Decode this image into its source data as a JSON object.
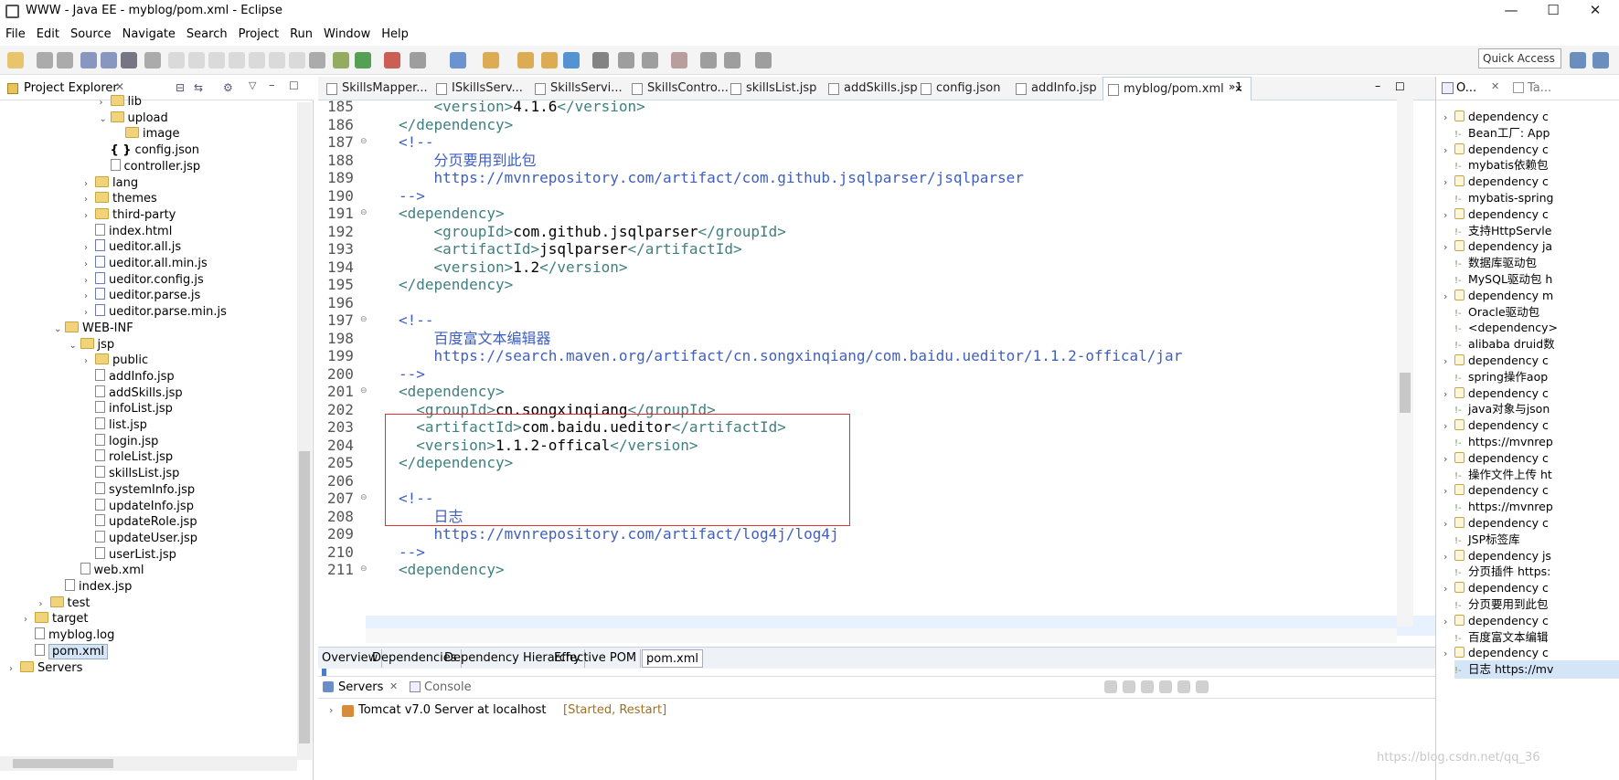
{
  "window": {
    "title": "WWW - Java EE - myblog/pom.xml - Eclipse"
  },
  "menu": [
    "File",
    "Edit",
    "Source",
    "Navigate",
    "Search",
    "Project",
    "Run",
    "Window",
    "Help"
  ],
  "quick_access": "Quick Access",
  "project_explorer": {
    "title": "Project Explorer",
    "items": [
      {
        "label": "lib",
        "type": "folder",
        "depth": 5,
        "twisty": ">"
      },
      {
        "label": "upload",
        "type": "folder",
        "depth": 5,
        "twisty": "v"
      },
      {
        "label": "image",
        "type": "folder",
        "depth": 6,
        "twisty": ""
      },
      {
        "label": "config.json",
        "type": "json",
        "depth": 5,
        "twisty": ""
      },
      {
        "label": "controller.jsp",
        "type": "file",
        "depth": 5,
        "twisty": ""
      },
      {
        "label": "lang",
        "type": "folder",
        "depth": 4,
        "twisty": ">"
      },
      {
        "label": "themes",
        "type": "folder",
        "depth": 4,
        "twisty": ">"
      },
      {
        "label": "third-party",
        "type": "folder",
        "depth": 4,
        "twisty": ">"
      },
      {
        "label": "index.html",
        "type": "file",
        "depth": 4,
        "twisty": ""
      },
      {
        "label": "ueditor.all.js",
        "type": "js",
        "depth": 4,
        "twisty": ">"
      },
      {
        "label": "ueditor.all.min.js",
        "type": "js",
        "depth": 4,
        "twisty": ">"
      },
      {
        "label": "ueditor.config.js",
        "type": "js",
        "depth": 4,
        "twisty": ">"
      },
      {
        "label": "ueditor.parse.js",
        "type": "js",
        "depth": 4,
        "twisty": ">"
      },
      {
        "label": "ueditor.parse.min.js",
        "type": "js",
        "depth": 4,
        "twisty": ">"
      },
      {
        "label": "WEB-INF",
        "type": "folder",
        "depth": 2,
        "twisty": "v"
      },
      {
        "label": "jsp",
        "type": "folder",
        "depth": 3,
        "twisty": "v"
      },
      {
        "label": "public",
        "type": "folder",
        "depth": 4,
        "twisty": ">"
      },
      {
        "label": "addInfo.jsp",
        "type": "file",
        "depth": 4,
        "twisty": ""
      },
      {
        "label": "addSkills.jsp",
        "type": "file",
        "depth": 4,
        "twisty": ""
      },
      {
        "label": "infoList.jsp",
        "type": "file",
        "depth": 4,
        "twisty": ""
      },
      {
        "label": "list.jsp",
        "type": "file",
        "depth": 4,
        "twisty": ""
      },
      {
        "label": "login.jsp",
        "type": "file",
        "depth": 4,
        "twisty": ""
      },
      {
        "label": "roleList.jsp",
        "type": "file",
        "depth": 4,
        "twisty": ""
      },
      {
        "label": "skillsList.jsp",
        "type": "file",
        "depth": 4,
        "twisty": ""
      },
      {
        "label": "systemInfo.jsp",
        "type": "file",
        "depth": 4,
        "twisty": ""
      },
      {
        "label": "updateInfo.jsp",
        "type": "file",
        "depth": 4,
        "twisty": ""
      },
      {
        "label": "updateRole.jsp",
        "type": "file",
        "depth": 4,
        "twisty": ""
      },
      {
        "label": "updateUser.jsp",
        "type": "file",
        "depth": 4,
        "twisty": ""
      },
      {
        "label": "userList.jsp",
        "type": "file",
        "depth": 4,
        "twisty": ""
      },
      {
        "label": "web.xml",
        "type": "file",
        "depth": 3,
        "twisty": ""
      },
      {
        "label": "index.jsp",
        "type": "file",
        "depth": 2,
        "twisty": ""
      },
      {
        "label": "test",
        "type": "folder",
        "depth": 1,
        "twisty": ">"
      },
      {
        "label": "target",
        "type": "folder",
        "depth": 0,
        "twisty": ">"
      },
      {
        "label": "myblog.log",
        "type": "file",
        "depth": 0,
        "twisty": ""
      },
      {
        "label": "pom.xml",
        "type": "file",
        "depth": 0,
        "twisty": "",
        "selected": true
      },
      {
        "label": "Servers",
        "type": "folder",
        "depth": -1,
        "twisty": ">"
      }
    ]
  },
  "editor_tabs": [
    {
      "label": "SkillsMapper...",
      "active": false
    },
    {
      "label": "ISkillsServ...",
      "active": false
    },
    {
      "label": "SkillsServi...",
      "active": false
    },
    {
      "label": "SkillsContro...",
      "active": false
    },
    {
      "label": "skillsList.jsp",
      "active": false
    },
    {
      "label": "addSkills.jsp",
      "active": false
    },
    {
      "label": "config.json",
      "active": false
    },
    {
      "label": "addInfo.jsp",
      "active": false
    },
    {
      "label": "myblog/pom.xml",
      "active": true
    }
  ],
  "editor_tabs_overflow": "»1",
  "code_lines": [
    {
      "n": "185",
      "parts": [
        [
          "tag",
          "    <version>"
        ],
        [
          "txt",
          "4.1.6"
        ],
        [
          "tag",
          "</version>"
        ]
      ]
    },
    {
      "n": "186",
      "parts": [
        [
          "tag",
          "</dependency>"
        ]
      ]
    },
    {
      "n": "187",
      "parts": [
        [
          "cm",
          "<!--"
        ]
      ]
    },
    {
      "n": "188",
      "parts": [
        [
          "cm",
          "    分页要用到此包"
        ]
      ]
    },
    {
      "n": "189",
      "parts": [
        [
          "cm",
          "    https://mvnrepository.com/artifact/com.github.jsqlparser/jsqlparser"
        ]
      ]
    },
    {
      "n": "190",
      "parts": [
        [
          "cm",
          "-->"
        ]
      ]
    },
    {
      "n": "191",
      "parts": [
        [
          "tag",
          "<dependency>"
        ]
      ]
    },
    {
      "n": "192",
      "parts": [
        [
          "tag",
          "    <groupId>"
        ],
        [
          "txt",
          "com.github.jsqlparser"
        ],
        [
          "tag",
          "</groupId>"
        ]
      ]
    },
    {
      "n": "193",
      "parts": [
        [
          "tag",
          "    <artifactId>"
        ],
        [
          "txt",
          "jsqlparser"
        ],
        [
          "tag",
          "</artifactId>"
        ]
      ]
    },
    {
      "n": "194",
      "parts": [
        [
          "tag",
          "    <version>"
        ],
        [
          "txt",
          "1.2"
        ],
        [
          "tag",
          "</version>"
        ]
      ]
    },
    {
      "n": "195",
      "parts": [
        [
          "tag",
          "</dependency>"
        ]
      ]
    },
    {
      "n": "196",
      "parts": []
    },
    {
      "n": "197",
      "parts": [
        [
          "cm",
          "<!--"
        ]
      ]
    },
    {
      "n": "198",
      "parts": [
        [
          "cm",
          "    百度富文本编辑器"
        ]
      ]
    },
    {
      "n": "199",
      "parts": [
        [
          "cm",
          "    https://search.maven.org/artifact/cn.songxinqiang/com.baidu.ueditor/1.1.2-offical/jar"
        ]
      ]
    },
    {
      "n": "200",
      "parts": [
        [
          "cm",
          "-->"
        ]
      ]
    },
    {
      "n": "201",
      "parts": [
        [
          "tag",
          "<dependency>"
        ]
      ]
    },
    {
      "n": "202",
      "parts": [
        [
          "tag",
          "  <groupId>"
        ],
        [
          "txt",
          "cn.songxinqiang"
        ],
        [
          "tag",
          "</groupId>"
        ]
      ]
    },
    {
      "n": "203",
      "parts": [
        [
          "tag",
          "  <artifactId>"
        ],
        [
          "txt",
          "com.baidu.ueditor"
        ],
        [
          "tag",
          "</artifactId>"
        ]
      ]
    },
    {
      "n": "204",
      "parts": [
        [
          "tag",
          "  <version>"
        ],
        [
          "txt",
          "1.1.2-offical"
        ],
        [
          "tag",
          "</version>"
        ]
      ]
    },
    {
      "n": "205",
      "parts": [
        [
          "tag",
          "</dependency>"
        ]
      ]
    },
    {
      "n": "206",
      "parts": []
    },
    {
      "n": "207",
      "parts": [
        [
          "cm",
          "<!--"
        ]
      ]
    },
    {
      "n": "208",
      "parts": [
        [
          "cm",
          "    日志"
        ]
      ]
    },
    {
      "n": "209",
      "parts": [
        [
          "cm",
          "    https://mvnrepository.com/artifact/log4j/log4j"
        ]
      ]
    },
    {
      "n": "210",
      "parts": [
        [
          "cm",
          "-->"
        ]
      ]
    },
    {
      "n": "211",
      "parts": [
        [
          "tag",
          "<dependency>"
        ]
      ]
    }
  ],
  "pom_tabs": [
    {
      "label": "Overview",
      "active": false
    },
    {
      "label": "Dependencies",
      "active": false
    },
    {
      "label": "Dependency Hierarchy",
      "active": false
    },
    {
      "label": "Effective POM",
      "active": false
    },
    {
      "label": "pom.xml",
      "active": true
    }
  ],
  "servers_view": {
    "tab_servers": "Servers",
    "tab_console": "Console",
    "server": "Tomcat v7.0 Server at localhost",
    "state": "[Started, Restart]"
  },
  "outline": {
    "tab1": "O...",
    "tab2": "Ta...",
    "items": [
      {
        "label": "dependency  c",
        "kind": "elem"
      },
      {
        "label": "Bean工厂: App",
        "kind": "comment"
      },
      {
        "label": "dependency  c",
        "kind": "elem"
      },
      {
        "label": "mybatis依赖包",
        "kind": "comment"
      },
      {
        "label": "dependency  c",
        "kind": "elem"
      },
      {
        "label": "mybatis-spring",
        "kind": "comment"
      },
      {
        "label": "dependency  c",
        "kind": "elem"
      },
      {
        "label": "支持HttpServle",
        "kind": "comment"
      },
      {
        "label": "dependency  ja",
        "kind": "elem"
      },
      {
        "label": "数据库驱动包",
        "kind": "comment"
      },
      {
        "label": "MySQL驱动包 h",
        "kind": "comment"
      },
      {
        "label": "dependency  m",
        "kind": "elem"
      },
      {
        "label": "Oracle驱动包",
        "kind": "comment"
      },
      {
        "label": "<dependency>",
        "kind": "comment"
      },
      {
        "label": "alibaba druid数",
        "kind": "comment"
      },
      {
        "label": "dependency  c",
        "kind": "elem"
      },
      {
        "label": "spring操作aop",
        "kind": "comment"
      },
      {
        "label": "dependency  c",
        "kind": "elem"
      },
      {
        "label": "java对象与json",
        "kind": "comment"
      },
      {
        "label": "dependency  c",
        "kind": "elem"
      },
      {
        "label": "https://mvnrep",
        "kind": "comment"
      },
      {
        "label": "dependency  c",
        "kind": "elem"
      },
      {
        "label": "操作文件上传 ht",
        "kind": "comment"
      },
      {
        "label": "dependency  c",
        "kind": "elem"
      },
      {
        "label": "https://mvnrep",
        "kind": "comment"
      },
      {
        "label": "dependency  c",
        "kind": "elem"
      },
      {
        "label": "JSP标签库",
        "kind": "comment"
      },
      {
        "label": "dependency  js",
        "kind": "elem"
      },
      {
        "label": "分页插件 https:",
        "kind": "comment"
      },
      {
        "label": "dependency  c",
        "kind": "elem"
      },
      {
        "label": "分页要用到此包",
        "kind": "comment"
      },
      {
        "label": "dependency  c",
        "kind": "elem"
      },
      {
        "label": "百度富文本编辑",
        "kind": "comment"
      },
      {
        "label": "dependency  c",
        "kind": "elem"
      },
      {
        "label": "日志 https://mv",
        "kind": "comment",
        "selected": true
      }
    ]
  },
  "watermark": "https://blog.csdn.net/qq_36"
}
